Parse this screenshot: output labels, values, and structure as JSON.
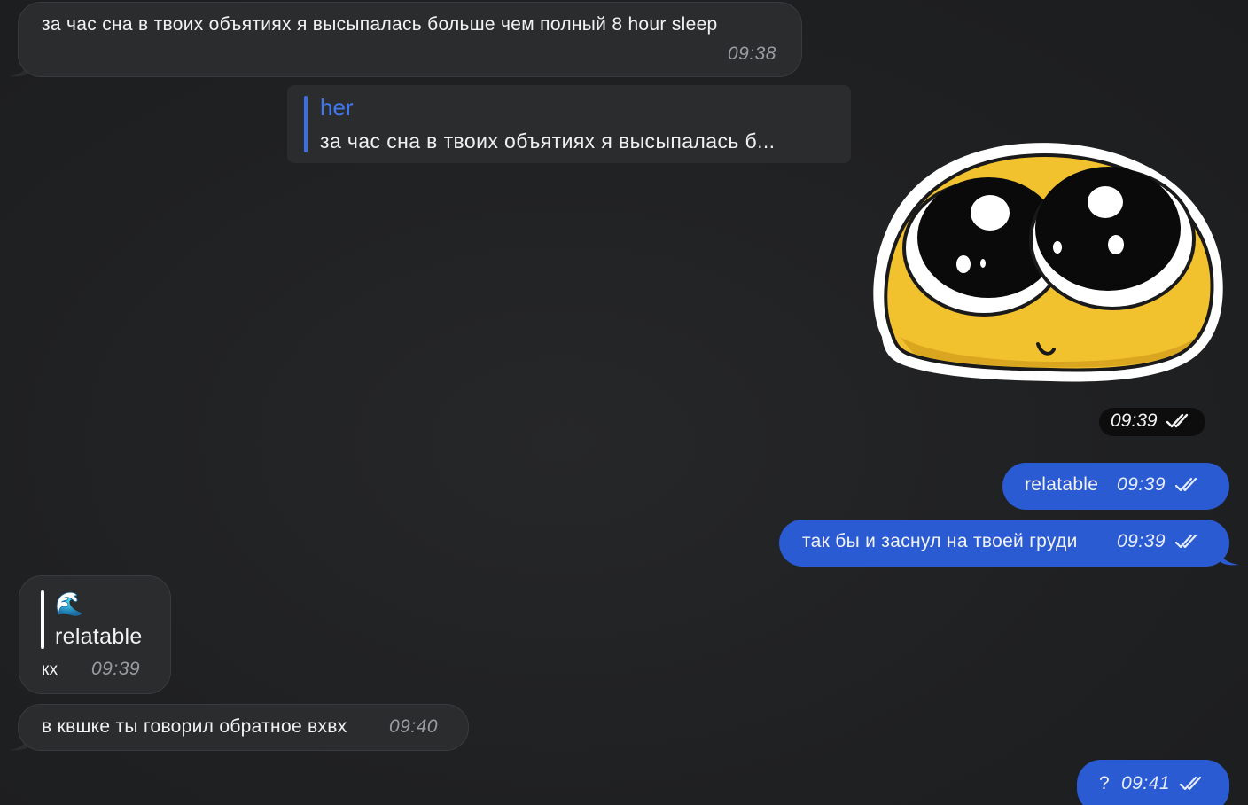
{
  "messages": {
    "m1": {
      "text": "за час сна в твоих объятиях я высыпалась больше чем полный 8 hour sleep",
      "time": "09:38"
    },
    "reply": {
      "author": "her",
      "snippet": "за час сна в твоих объятиях я высыпалась б..."
    },
    "sticker": {
      "name": "pleading-face-sticker",
      "time": "09:39"
    },
    "m2": {
      "text": "relatable",
      "time": "09:39"
    },
    "m3": {
      "text": "так бы и заснул на твоей груди",
      "time": "09:39"
    },
    "m4": {
      "quote_emoji": "🌊",
      "quote_text": "relatable",
      "text": "кх",
      "time": "09:39"
    },
    "m5": {
      "text": "в квшке ты говорил обратное вхвх",
      "time": "09:40"
    },
    "m6": {
      "text": "?",
      "time": "09:41"
    }
  },
  "colors": {
    "background": "#202124",
    "incoming_bubble": "#2b2c2e",
    "outgoing_bubble": "#2a5bd3",
    "reply_accent": "#3f78f0"
  },
  "icons": {
    "read_receipt": "double-check-icon"
  }
}
